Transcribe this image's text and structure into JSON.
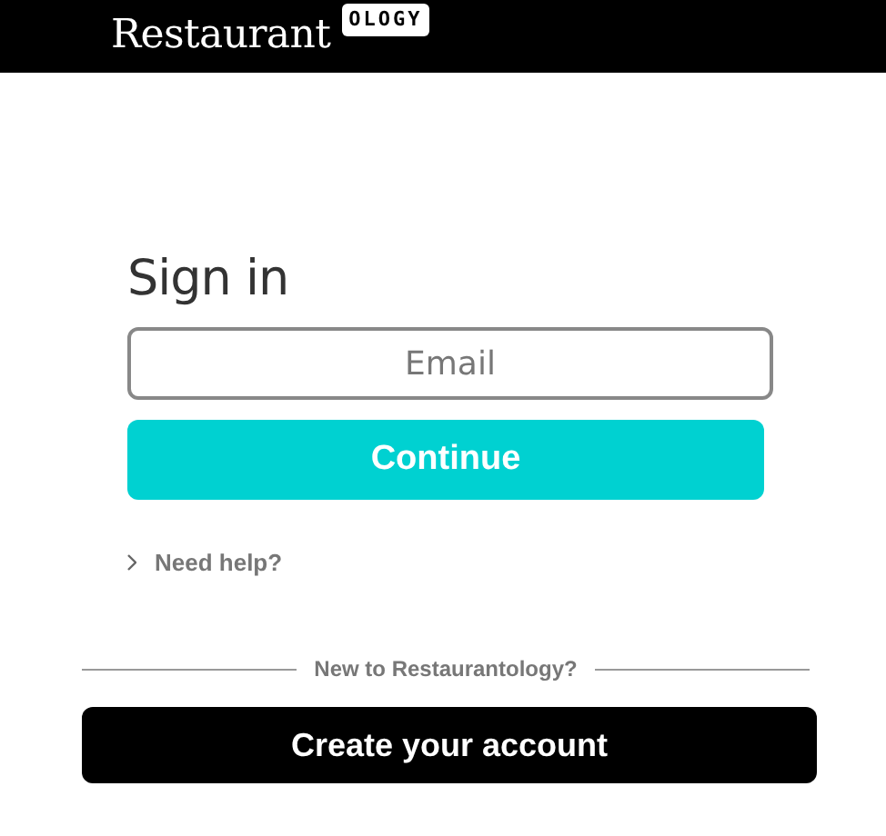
{
  "header": {
    "logo_text": "Restaurant",
    "logo_badge": "OLOGY"
  },
  "sign_in": {
    "title": "Sign in",
    "email": {
      "placeholder": "Email"
    },
    "continue_button": "Continue",
    "help_link": "Need help?"
  },
  "signup": {
    "prompt": "New to Restaurantology?",
    "create_button": "Create your account"
  }
}
